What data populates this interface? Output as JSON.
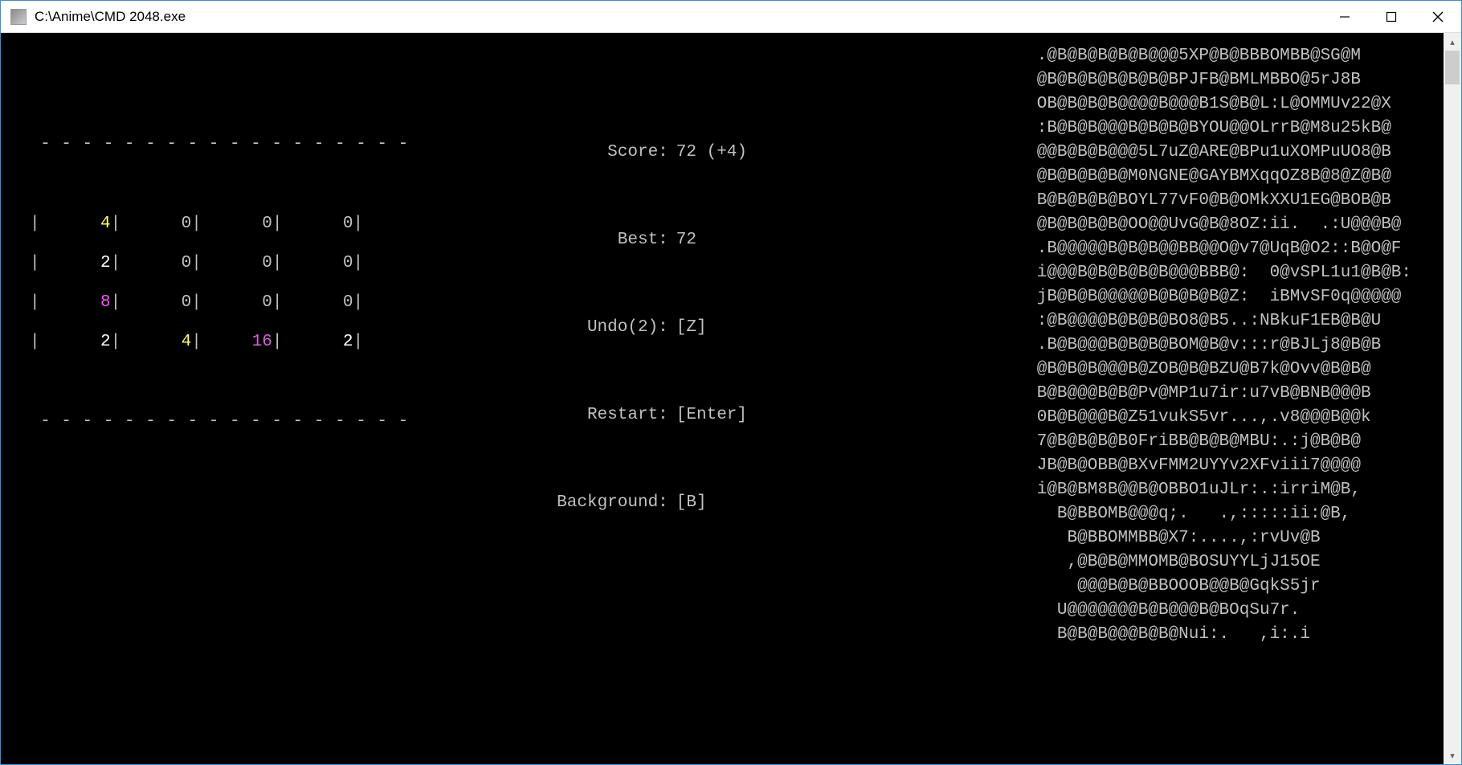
{
  "window": {
    "title": "C:\\Anime\\CMD 2048.exe"
  },
  "game": {
    "grid": [
      [
        4,
        0,
        0,
        0
      ],
      [
        2,
        0,
        0,
        0
      ],
      [
        8,
        0,
        0,
        0
      ],
      [
        2,
        4,
        16,
        2
      ]
    ],
    "score": 72,
    "score_delta": 4,
    "best": 72,
    "undo_remaining": 2,
    "undo_key": "[Z]",
    "restart_key": "[Enter]",
    "background_key": "[B]",
    "labels": {
      "score": "Score:",
      "best": "Best:",
      "undo": "Undo",
      "restart": "Restart:",
      "background": "Background:"
    }
  },
  "ascii_art": [
    ".@B@B@B@B@B@@@5XP@B@BBBOMBB@SG@M",
    "@B@B@B@B@B@B@BPJFB@BMLMBBO@5rJ8B",
    "OB@B@B@B@@@@B@@@B1S@B@L:L@OMMUv22@X",
    ":B@B@B@@@B@B@B@BYOU@@OLrrB@M8u25kB@",
    "@@B@B@B@@@5L7uZ@ARE@BPu1uXOMPuUO8@B",
    "@B@B@B@B@M0NGNE@GAYBMXqqOZ8B@8@Z@B@",
    "B@B@B@B@BOYL77vF0@B@OMkXXU1EG@BOB@B",
    "@B@B@B@B@OO@@UvG@B@8OZ:ii.  .:U@@@B@",
    ".B@@@@@B@B@B@@BB@@O@v7@UqB@O2::B@O@F",
    "i@@@B@B@B@B@B@@@BBB@:  0@vSPL1u1@B@B:",
    "jB@B@B@@@@@B@B@B@B@Z:  iBMvSF0q@@@@@",
    ":@B@@@@B@B@B@BO8@B5..:NBkuF1EB@B@U",
    ".B@B@@@B@B@B@BOM@B@v:::r@BJLj8@B@B",
    "@B@B@B@@@B@ZOB@B@BZU@B7k@Ovv@B@B@",
    "B@B@@@B@B@Pv@MP1u7ir:u7vB@BNB@@@B",
    "0B@B@@@B@Z51vukS5vr...,.v8@@@B@@k",
    "7@B@B@B@B0FriBB@B@B@MBU:.:j@B@B@",
    "JB@B@OBB@BXvFMM2UYYv2XFviii7@@@@",
    "i@B@BM8B@@B@OBBO1uJLr:.:irriM@B,",
    "  B@BBOMB@@@q;.   .,:::::ii:@B,",
    "   B@BBOMMBB@X7:....,:rvUv@B",
    "   ,@B@B@MMOMB@BOSUYYLjJ15OE",
    "    @@@B@B@BBOOOB@@B@GqkS5jr",
    "  U@@@@@@@B@B@@@B@BOqSu7r.",
    "  B@B@B@@@B@B@Nui:.   ,i:.i"
  ]
}
